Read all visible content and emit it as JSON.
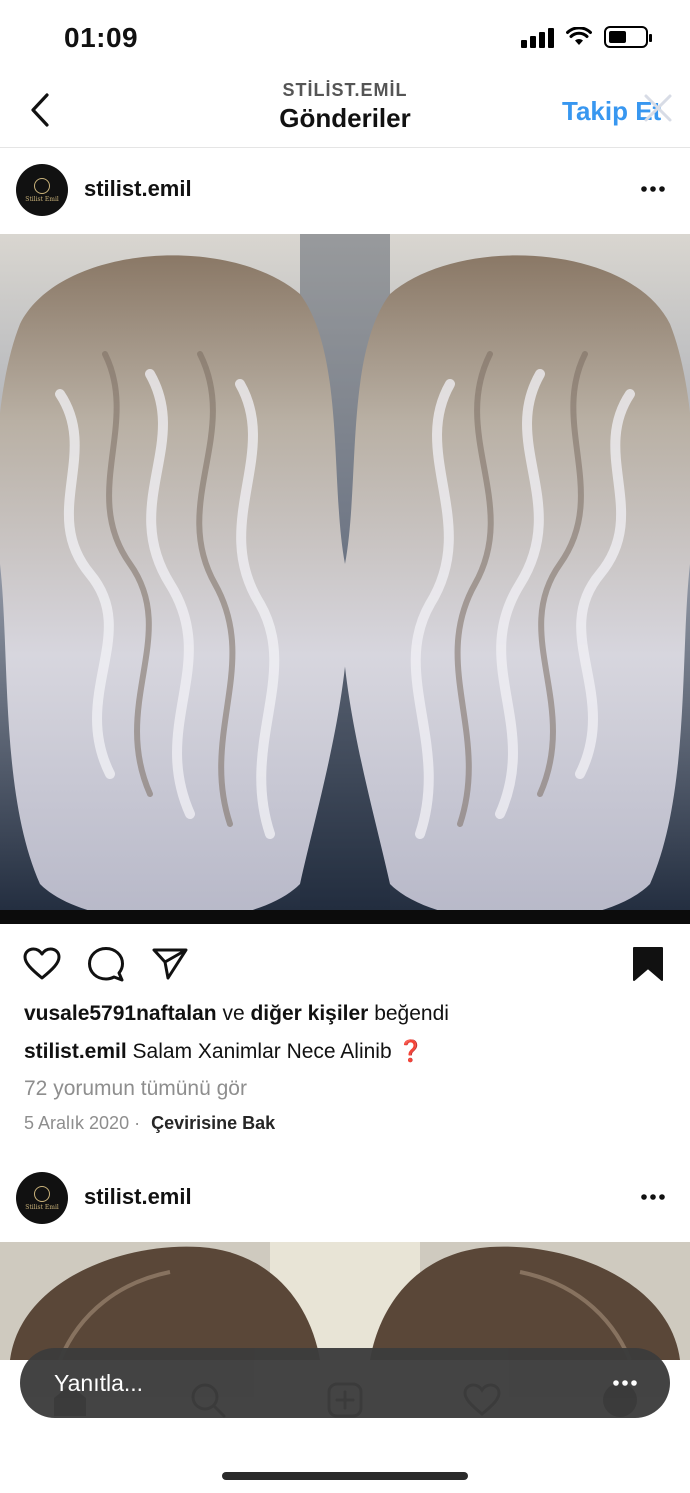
{
  "status_bar": {
    "time": "01:09",
    "battery_level": 0.5
  },
  "header": {
    "subtitle": "STİLİST.EMİL",
    "title": "Gönderiler",
    "follow_label": "Takip Et"
  },
  "posts": [
    {
      "username": "stilist.emil",
      "avatar_text": "Stilist Emil",
      "likes": {
        "user": "vusale5791naftalan",
        "connector": " ve ",
        "others": "diğer kişiler",
        "suffix": " beğendi"
      },
      "caption": {
        "user": "stilist.emil",
        "text": " Salam Xanimlar Nece Alinib",
        "emoji": "❓"
      },
      "view_comments": "72 yorumun tümünü gör",
      "date": "5 Aralık 2020",
      "separator": "·",
      "translate": "Çevirisine Bak"
    },
    {
      "username": "stilist.emil",
      "avatar_text": "Stilist Emil"
    }
  ],
  "reply_bar": {
    "placeholder": "Yanıtla..."
  },
  "icons": {
    "back": "chevron-left-icon",
    "close": "close-icon",
    "more": "more-horizontal-icon",
    "like": "heart-icon",
    "comment": "comment-icon",
    "share": "send-icon",
    "save": "bookmark-icon"
  },
  "colors": {
    "accent": "#3897f0",
    "text": "#111111",
    "muted": "#8e8e8e",
    "reply_bg": "#3c3c3c"
  }
}
